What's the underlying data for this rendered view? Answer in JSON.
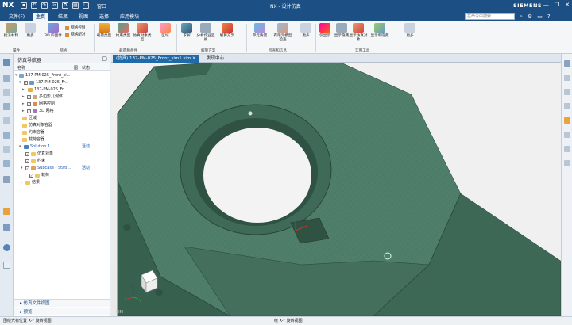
{
  "titlebar": {
    "logo": "NX",
    "title": "NX - 设计仿真",
    "brand": "SIEMENS",
    "window_menu": "窗口",
    "minimize": "—",
    "restore": "❐",
    "close": "✕"
  },
  "menubar": {
    "items": [
      "文件(F)",
      "主页",
      "结果",
      "视图",
      "选择",
      "应用模块"
    ],
    "active": "主页",
    "search_placeholder": "在命令中搜索"
  },
  "ribbon": {
    "buttons": [
      "指派材料",
      "更多",
      "3D 四面体",
      "载荷类型",
      "约束类型",
      "仿真对象类型",
      "区域",
      "求解",
      "分析作业监视",
      "解算方案",
      "单元质量",
      "有限元模型检查",
      "更多",
      "仅显示",
      "显示隐藏",
      "显示仿真对象",
      "显示和隐藏",
      "更多"
    ],
    "small": [
      "属性",
      "网格控制",
      "网格配对"
    ],
    "groups": [
      "属性",
      "网格",
      "载荷和条件",
      "解算方案",
      "检查和信息",
      "实用工具"
    ]
  },
  "navigator": {
    "title": "仿真导航器",
    "col_name": "名称",
    "col_status": "状态",
    "rows": [
      {
        "label": "137-PM-025_Front_si...",
        "status": ""
      },
      {
        "label": "137-PM-025_Fr...",
        "status": ""
      },
      {
        "label": "137-PM-025_Fr...",
        "status": ""
      },
      {
        "label": "多边形几何体",
        "status": ""
      },
      {
        "label": "网格控制",
        "status": ""
      },
      {
        "label": "3D 网格",
        "status": ""
      },
      {
        "label": "区域",
        "status": ""
      },
      {
        "label": "仿真对象容器",
        "status": ""
      },
      {
        "label": "约束容器",
        "status": ""
      },
      {
        "label": "载荷容器",
        "status": ""
      },
      {
        "label": "Solution 1",
        "status": "活动"
      },
      {
        "label": "仿真对象",
        "status": ""
      },
      {
        "label": "约束",
        "status": ""
      },
      {
        "label": "Subcase - Stati...",
        "status": "活动"
      },
      {
        "label": "载荷",
        "status": ""
      },
      {
        "label": "结果",
        "status": ""
      }
    ],
    "footer_preview": "仿真文件视图",
    "footer_more": "预览"
  },
  "viewtabs": {
    "active": "(仿真) 137-PM-025_Front_sim1.sim",
    "other": "发现中心"
  },
  "viewport": {
    "triad_x": "X",
    "triad_y": "Y",
    "triad_z": "Z",
    "corner_label": "SIM"
  },
  "statusbar": {
    "left": "围绕光标位置 X-Y 旋转视图",
    "center": "绕 X-Y 旋转视图"
  },
  "colors": {
    "model": "#4a7a66",
    "model_dark": "#355a4a",
    "title_bg": "#1c4f84",
    "accent": "#1f6aa8"
  }
}
